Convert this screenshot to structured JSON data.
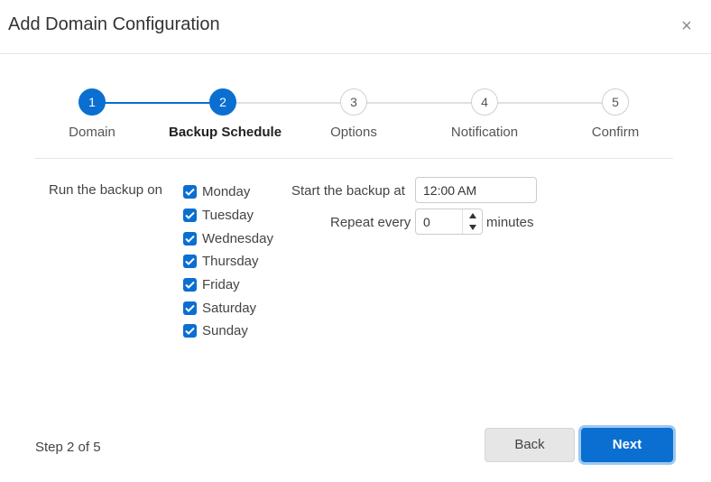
{
  "dialog": {
    "title": "Add Domain Configuration",
    "close_glyph": "×"
  },
  "stepper": {
    "current": 2,
    "steps": [
      {
        "number": "1",
        "label": "Domain",
        "state": "complete"
      },
      {
        "number": "2",
        "label": "Backup Schedule",
        "state": "current"
      },
      {
        "number": "3",
        "label": "Options",
        "state": "upcoming"
      },
      {
        "number": "4",
        "label": "Notification",
        "state": "upcoming"
      },
      {
        "number": "5",
        "label": "Confirm",
        "state": "upcoming"
      }
    ]
  },
  "schedule": {
    "run_label": "Run the backup on",
    "days": [
      {
        "label": "Monday",
        "checked": true
      },
      {
        "label": "Tuesday",
        "checked": true
      },
      {
        "label": "Wednesday",
        "checked": true
      },
      {
        "label": "Thursday",
        "checked": true
      },
      {
        "label": "Friday",
        "checked": true
      },
      {
        "label": "Saturday",
        "checked": true
      },
      {
        "label": "Sunday",
        "checked": true
      }
    ],
    "start_label": "Start the backup at",
    "start_time": "12:00 AM",
    "repeat_label": "Repeat every",
    "repeat_value": "0",
    "repeat_unit": "minutes"
  },
  "footer": {
    "step_count": "Step 2 of 5",
    "back_label": "Back",
    "next_label": "Next"
  },
  "colors": {
    "accent": "#0a6fd0",
    "track_inactive": "#e0e0e0",
    "next_focus_ring": "#9cc8f0"
  },
  "icons": {
    "close": "close-icon",
    "checkbox": "checkmark-icon",
    "spin_up": "caret-up-icon",
    "spin_down": "caret-down-icon"
  }
}
